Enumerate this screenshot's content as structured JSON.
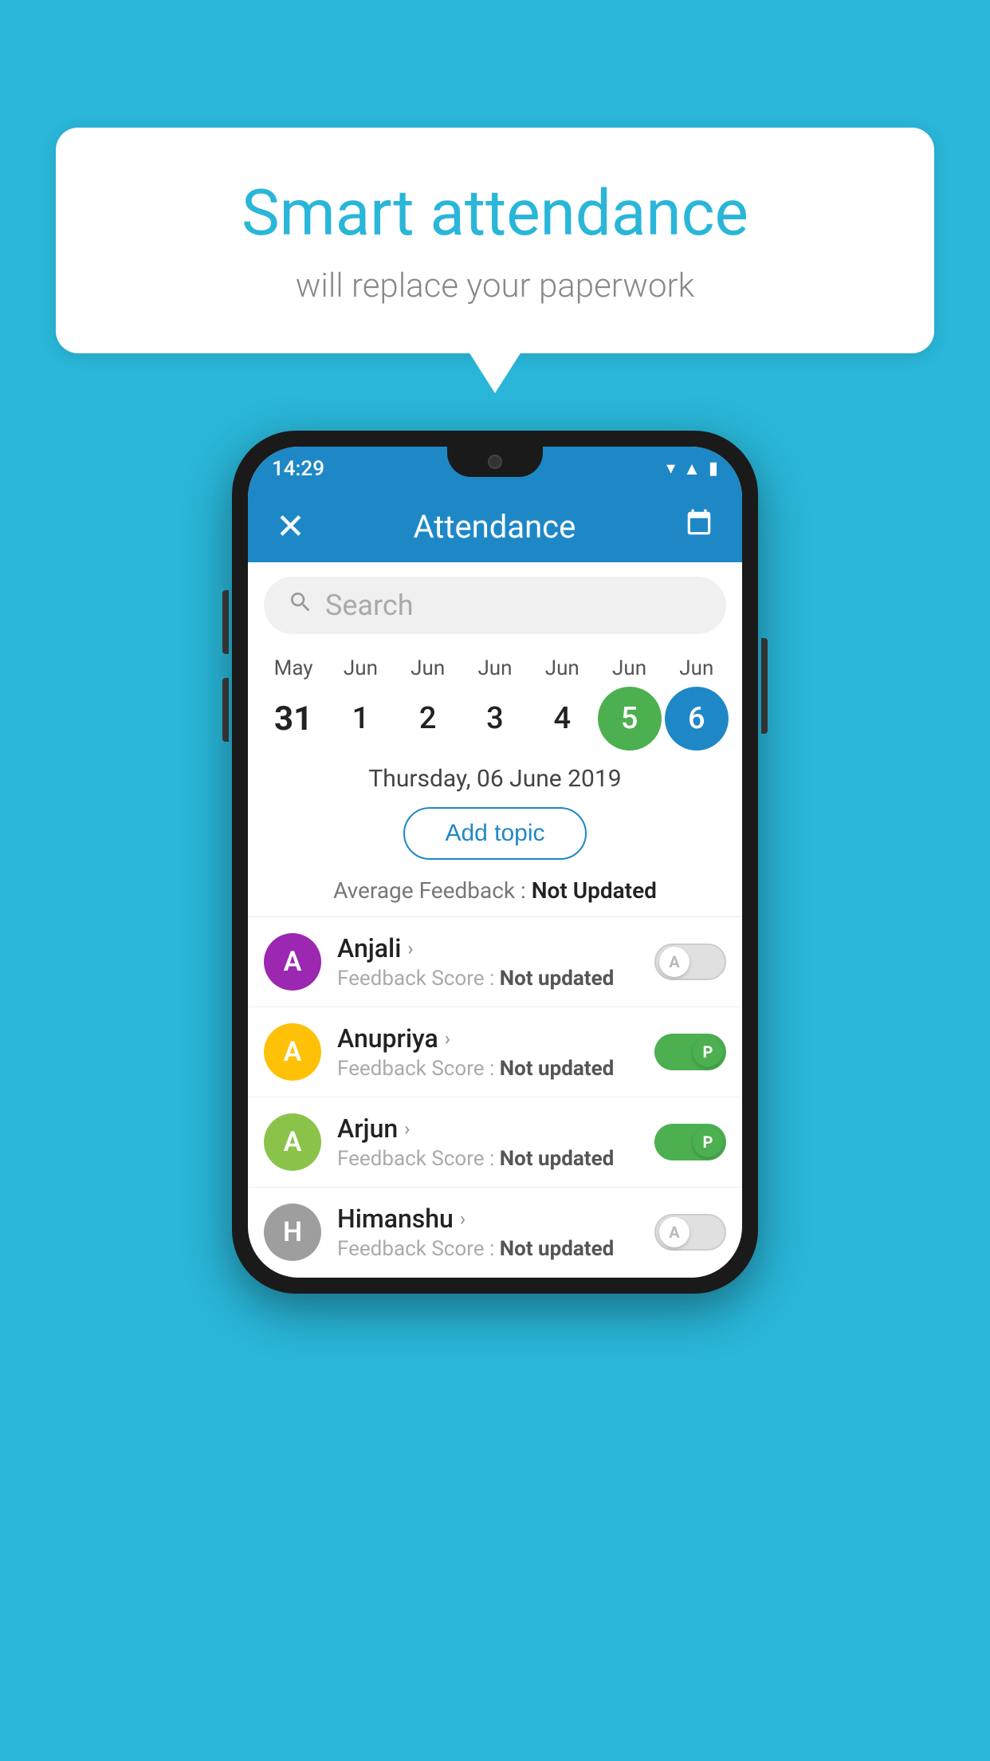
{
  "background_color": "#29b6d8",
  "speech_bubble": {
    "title": "Smart attendance",
    "subtitle": "will replace your paperwork"
  },
  "phone": {
    "status_bar": {
      "time": "14:29",
      "icons": [
        "wifi",
        "signal",
        "battery"
      ]
    },
    "header": {
      "title": "Attendance",
      "close_label": "×",
      "calendar_icon": "📅"
    },
    "search": {
      "placeholder": "Search"
    },
    "calendar": {
      "months": [
        "May",
        "Jun",
        "Jun",
        "Jun",
        "Jun",
        "Jun",
        "Jun"
      ],
      "days": [
        {
          "day": 31,
          "state": "normal",
          "bold": true
        },
        {
          "day": 1,
          "state": "normal",
          "bold": false
        },
        {
          "day": 2,
          "state": "normal",
          "bold": false
        },
        {
          "day": 3,
          "state": "normal",
          "bold": false
        },
        {
          "day": 4,
          "state": "normal",
          "bold": false
        },
        {
          "day": 5,
          "state": "today",
          "bold": false
        },
        {
          "day": 6,
          "state": "selected",
          "bold": false
        }
      ]
    },
    "selected_date": "Thursday, 06 June 2019",
    "add_topic_label": "Add topic",
    "avg_feedback_label": "Average Feedback : ",
    "avg_feedback_value": "Not Updated",
    "students": [
      {
        "name": "Anjali",
        "avatar_letter": "A",
        "avatar_color": "#9c27b0",
        "feedback_label": "Feedback Score : ",
        "feedback_value": "Not updated",
        "toggle": "off",
        "toggle_letter": "A"
      },
      {
        "name": "Anupriya",
        "avatar_letter": "A",
        "avatar_color": "#ffc107",
        "feedback_label": "Feedback Score : ",
        "feedback_value": "Not updated",
        "toggle": "on",
        "toggle_letter": "P"
      },
      {
        "name": "Arjun",
        "avatar_letter": "A",
        "avatar_color": "#8bc34a",
        "feedback_label": "Feedback Score : ",
        "feedback_value": "Not updated",
        "toggle": "on",
        "toggle_letter": "P"
      },
      {
        "name": "Himanshu",
        "avatar_letter": "H",
        "avatar_color": "#9e9e9e",
        "feedback_label": "Feedback Score : ",
        "feedback_value": "Not updated",
        "toggle": "off",
        "toggle_letter": "A"
      }
    ]
  }
}
